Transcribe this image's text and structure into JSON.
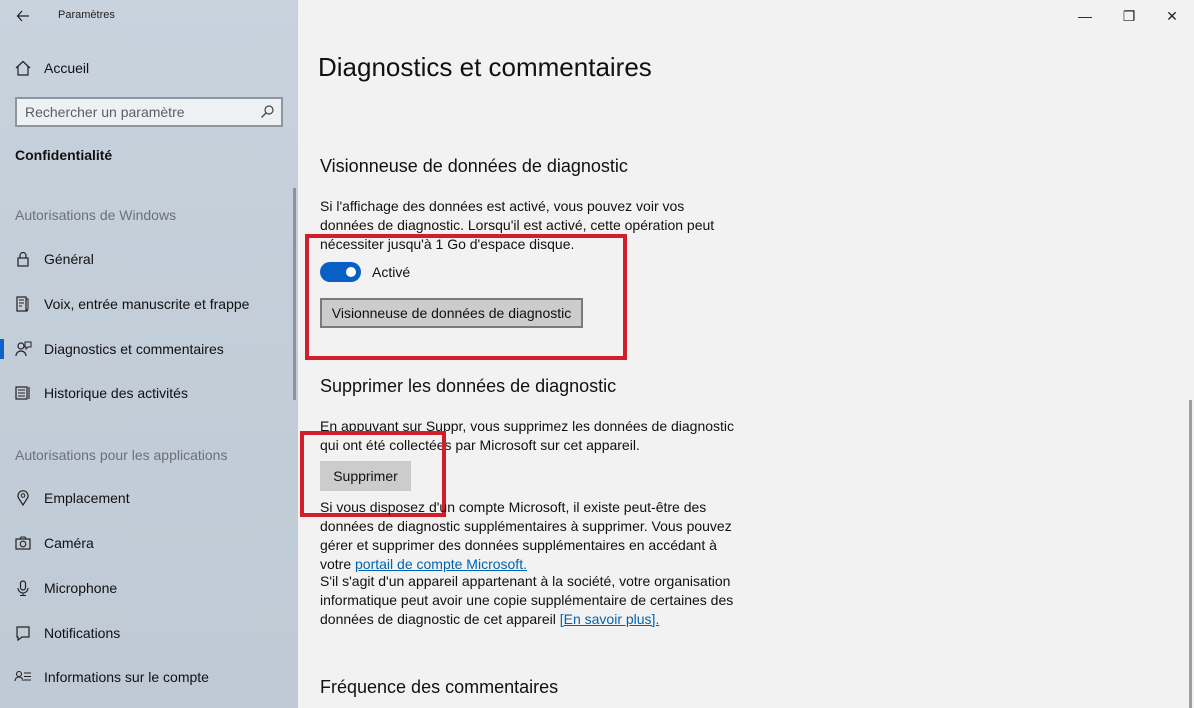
{
  "window": {
    "title": "Paramètres",
    "controls": {
      "minimize": "—",
      "restore": "❐",
      "close": "✕"
    }
  },
  "sidebar": {
    "home_label": "Accueil",
    "search_placeholder": "Rechercher un paramètre",
    "section_title": "Confidentialité",
    "groups": [
      {
        "title": "Autorisations de Windows",
        "items": [
          {
            "label": "Général",
            "icon": "lock-icon"
          },
          {
            "label": "Voix, entrée manuscrite et frappe",
            "icon": "pen-icon"
          },
          {
            "label": "Diagnostics et commentaires",
            "icon": "person-feedback-icon",
            "selected": true
          },
          {
            "label": "Historique des activités",
            "icon": "activity-history-icon"
          }
        ]
      },
      {
        "title": "Autorisations pour les applications",
        "items": [
          {
            "label": "Emplacement",
            "icon": "location-icon"
          },
          {
            "label": "Caméra",
            "icon": "camera-icon"
          },
          {
            "label": "Microphone",
            "icon": "microphone-icon"
          },
          {
            "label": "Notifications",
            "icon": "notifications-icon"
          },
          {
            "label": "Informations sur le compte",
            "icon": "account-info-icon"
          }
        ]
      }
    ]
  },
  "main": {
    "page_title": "Diagnostics et commentaires",
    "viewer": {
      "heading": "Visionneuse de données de diagnostic",
      "description": "Si l'affichage des données est activé, vous pouvez voir vos données de diagnostic. Lorsqu'il est activé, cette opération peut nécessiter jusqu'à 1 Go d'espace disque.",
      "toggle_state": "on",
      "toggle_label": "Activé",
      "button_label": "Visionneuse de données de diagnostic"
    },
    "delete": {
      "heading": "Supprimer les données de diagnostic",
      "description": "En appuyant sur Suppr, vous supprimez les données de diagnostic qui ont été collectées par Microsoft sur cet appareil.",
      "button_label": "Supprimer",
      "account_text": "Si vous disposez d'un compte Microsoft, il existe peut-être des données de diagnostic supplémentaires à supprimer. Vous pouvez gérer et supprimer des données supplémentaires en accédant à votre",
      "account_link": "portail de compte Microsoft.",
      "company_text": "S'il s'agit d'un appareil appartenant à la société, votre organisation informatique peut avoir une copie supplémentaire de certaines des données de diagnostic de cet appareil",
      "learn_more_link": "[En savoir plus]."
    },
    "feedback": {
      "heading": "Fréquence des commentaires"
    }
  },
  "colors": {
    "accent": "#0a5fc4",
    "highlight_box": "#d01f2b",
    "link": "#0063b1"
  }
}
